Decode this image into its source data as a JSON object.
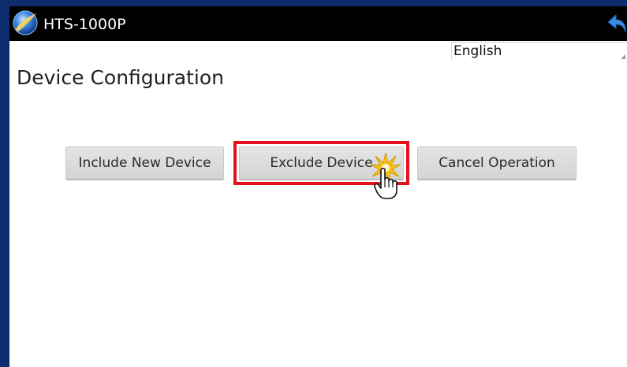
{
  "app": {
    "title": "HTS-1000P",
    "logo_icon": "globe-logo-icon",
    "back_icon": "back-arrow-icon"
  },
  "language": {
    "selected": "English"
  },
  "page": {
    "title": "Device Configuration"
  },
  "buttons": {
    "include": "Include New Device",
    "exclude": "Exclude Device",
    "cancel": "Cancel Operation"
  },
  "overlay": {
    "highlight_color": "#e3101d",
    "highlighted_button": "Exclude Device",
    "cursor_icon": "hand-pointer-icon",
    "click_effect_icon": "click-burst-icon"
  },
  "colors": {
    "frame": "#0d2c6e",
    "action_bar": "#000000",
    "button_bg": "#dcdcdc"
  }
}
